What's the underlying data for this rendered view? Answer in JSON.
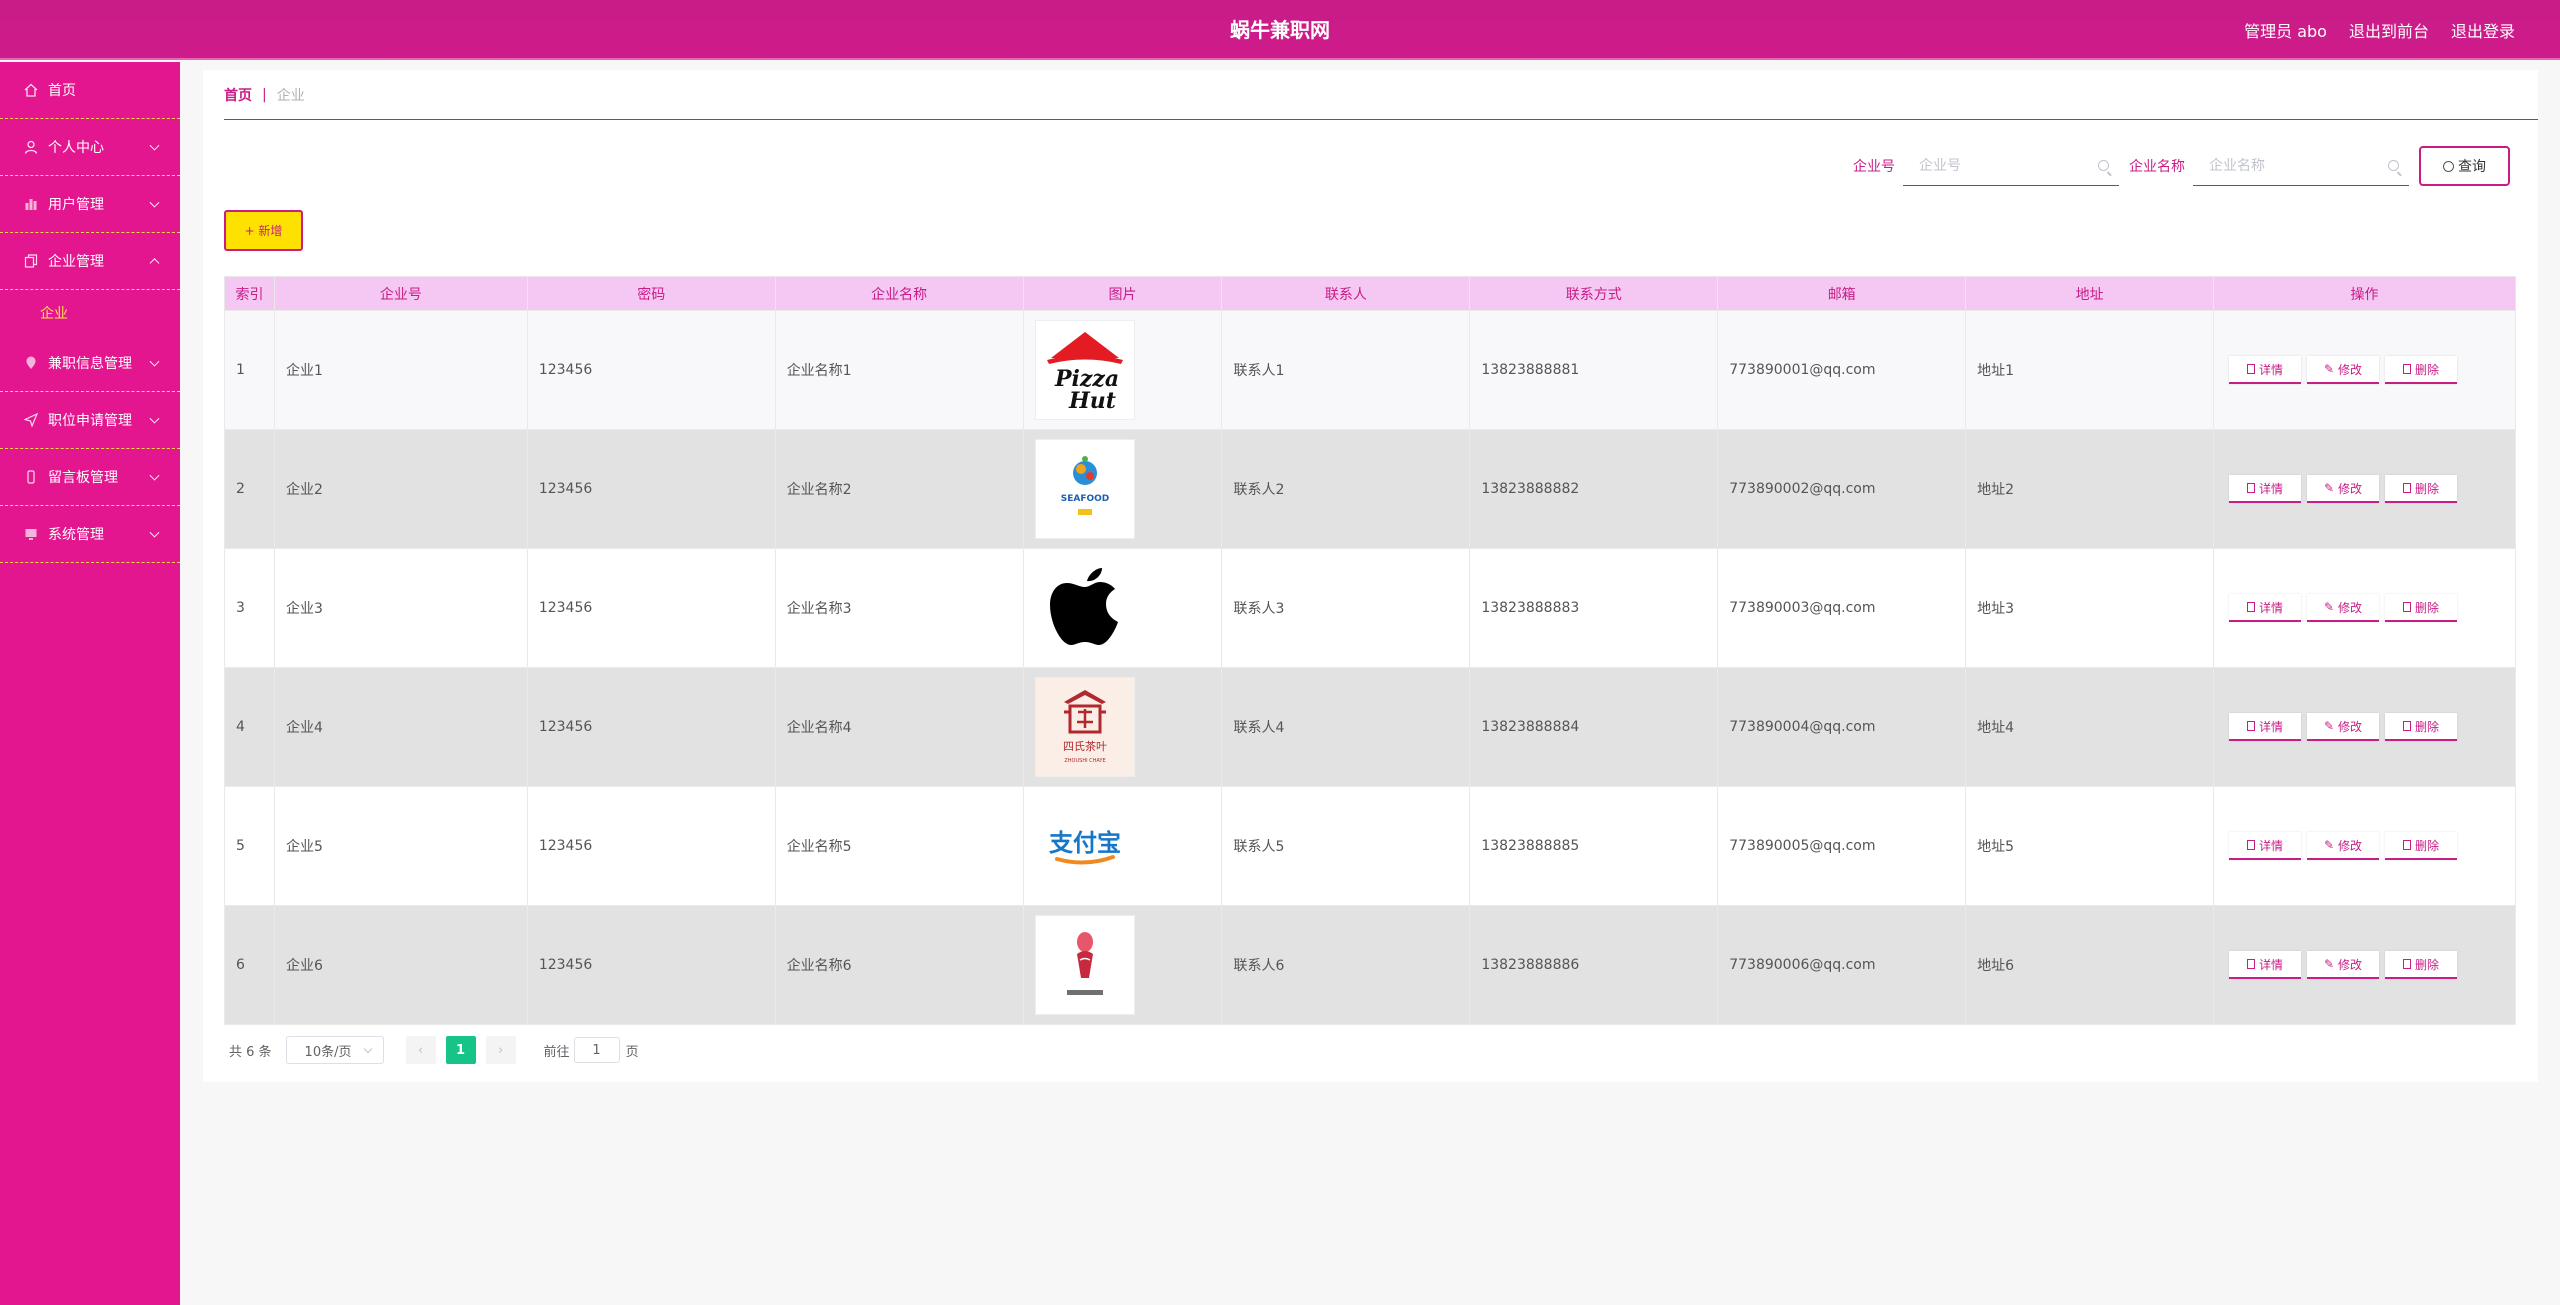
{
  "app": {
    "title": "蜗牛兼职网",
    "admin_label": "管理员 abo",
    "to_front": "退出到前台",
    "logout": "退出登录"
  },
  "sidebar": {
    "items": [
      {
        "label": "首页",
        "icon": "home-icon"
      },
      {
        "label": "个人中心",
        "icon": "user-icon"
      },
      {
        "label": "用户管理",
        "icon": "chart-icon"
      },
      {
        "label": "企业管理",
        "icon": "copy-icon",
        "expanded": true,
        "children": [
          {
            "label": "企业"
          }
        ]
      },
      {
        "label": "兼职信息管理",
        "icon": "location-icon"
      },
      {
        "label": "职位申请管理",
        "icon": "send-icon"
      },
      {
        "label": "留言板管理",
        "icon": "phone-icon"
      },
      {
        "label": "系统管理",
        "icon": "screen-icon"
      }
    ]
  },
  "breadcrumb": {
    "home": "首页",
    "separator": "|",
    "current": "企业"
  },
  "search": {
    "field1_label": "企业号",
    "field1_placeholder": "企业号",
    "field2_label": "企业名称",
    "field2_placeholder": "企业名称",
    "query_button": "查询"
  },
  "toolbar": {
    "add_label": "+ 新增"
  },
  "table": {
    "headers": [
      "索引",
      "企业号",
      "密码",
      "企业名称",
      "图片",
      "联系人",
      "联系方式",
      "邮箱",
      "地址",
      "操作"
    ],
    "rows": [
      {
        "index": "1",
        "code": "企业1",
        "password": "123456",
        "name": "企业名称1",
        "logo": "pizza-hut-logo",
        "contact": "联系人1",
        "phone": "13823888881",
        "email": "773890001@qq.com",
        "address": "地址1"
      },
      {
        "index": "2",
        "code": "企业2",
        "password": "123456",
        "name": "企业名称2",
        "logo": "seafood-logo",
        "contact": "联系人2",
        "phone": "13823888882",
        "email": "773890002@qq.com",
        "address": "地址2"
      },
      {
        "index": "3",
        "code": "企业3",
        "password": "123456",
        "name": "企业名称3",
        "logo": "apple-logo",
        "contact": "联系人3",
        "phone": "13823888883",
        "email": "773890003@qq.com",
        "address": "地址3"
      },
      {
        "index": "4",
        "code": "企业4",
        "password": "123456",
        "name": "企业名称4",
        "logo": "chinese-tea-logo",
        "contact": "联系人4",
        "phone": "13823888884",
        "email": "773890004@qq.com",
        "address": "地址4"
      },
      {
        "index": "5",
        "code": "企业5",
        "password": "123456",
        "name": "企业名称5",
        "logo": "alipay-logo",
        "contact": "联系人5",
        "phone": "13823888885",
        "email": "773890005@qq.com",
        "address": "地址5"
      },
      {
        "index": "6",
        "code": "企业6",
        "password": "123456",
        "name": "企业名称6",
        "logo": "dessert-logo",
        "contact": "联系人6",
        "phone": "13823888886",
        "email": "773890006@qq.com",
        "address": "地址6"
      }
    ],
    "actions": {
      "detail": "详情",
      "edit": "修改",
      "delete": "删除"
    }
  },
  "pagination": {
    "total_text": "共 6 条",
    "page_size": "10条/页",
    "current_page": "1",
    "goto_label": "前往",
    "goto_value": "1",
    "page_suffix": "页"
  },
  "colors": {
    "primary": "#c81d86",
    "sidebar_bg": "#e4168f",
    "header_bg": "#f5c7f3",
    "accent_yellow": "#ffe100",
    "page_active": "#17c488"
  }
}
